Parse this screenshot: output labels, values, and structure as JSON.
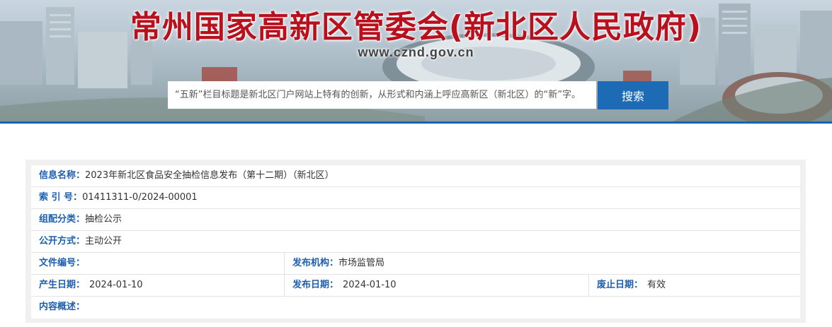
{
  "header": {
    "title": "常州国家高新区管委会(新北区人民政府)",
    "domain": "www.cznd.gov.cn"
  },
  "search": {
    "placeholder": "“五新”栏目标题是新北区门户网站上特有的创新，从形式和内涵上呼应高新区（新北区）的“新”字。",
    "button_label": "搜索"
  },
  "info": {
    "name": {
      "label": "信息名称：",
      "value": "2023年新北区食品安全抽检信息发布（第十二期）（新北区）"
    },
    "index": {
      "label": "索 引 号：",
      "value": "01411311-0/2024-00001"
    },
    "category": {
      "label": "组配分类：",
      "value": "抽检公示"
    },
    "disclosure": {
      "label": "公开方式：",
      "value": "主动公开"
    },
    "doc_no": {
      "label": "文件编号：",
      "value": ""
    },
    "publisher": {
      "label": "发布机构：",
      "value": "市场监管局"
    },
    "created": {
      "label": "产生日期：",
      "value": "2024-01-10"
    },
    "published": {
      "label": "发布日期：",
      "value": "2024-01-10"
    },
    "expiry": {
      "label": "废止日期：",
      "value": "有效"
    },
    "summary": {
      "label": "内容概述：",
      "value": ""
    }
  },
  "colors": {
    "title_red": "#b8101c",
    "accent_blue": "#1d6bb5",
    "label_blue": "#1d5fae"
  }
}
